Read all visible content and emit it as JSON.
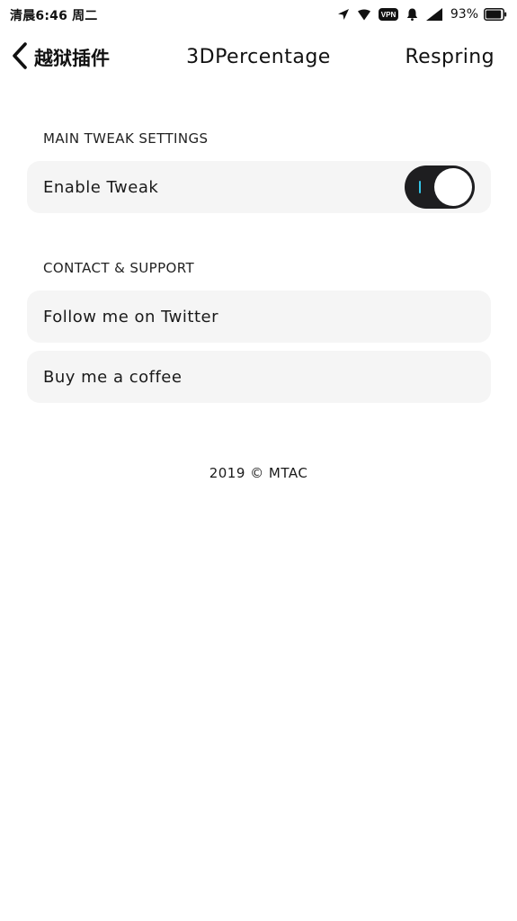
{
  "status_bar": {
    "time_text": "清晨6:46 周二",
    "vpn_label": "VPN",
    "battery_percent": "93%",
    "battery_level": 0.93,
    "icons": [
      "location-arrow-icon",
      "wifi-icon",
      "vpn-icon",
      "bell-icon",
      "cellular-signal-icon",
      "battery-icon"
    ]
  },
  "nav": {
    "back_label": "越狱插件",
    "title": "3DPercentage",
    "action_label": "Respring"
  },
  "sections": {
    "main": {
      "header": "MAIN TWEAK SETTINGS",
      "enable_tweak_label": "Enable Tweak",
      "enable_tweak_on": true
    },
    "contact": {
      "header": "CONTACT & SUPPORT",
      "twitter_label": "Follow me on Twitter",
      "coffee_label": "Buy me a coffee"
    }
  },
  "footer": {
    "text": "2019 © MTAC"
  },
  "colors": {
    "background": "#ffffff",
    "cell_background": "#f5f5f5",
    "toggle_track": "#1e1e20",
    "toggle_on_mark": "#35c4e6",
    "text": "#1a1a1a"
  }
}
